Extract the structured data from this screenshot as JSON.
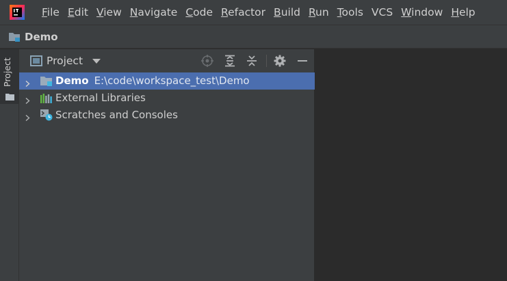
{
  "menubar": {
    "items": [
      {
        "mnemonic": "F",
        "rest": "ile"
      },
      {
        "mnemonic": "E",
        "rest": "dit"
      },
      {
        "mnemonic": "V",
        "rest": "iew"
      },
      {
        "mnemonic": "N",
        "rest": "avigate"
      },
      {
        "mnemonic": "C",
        "rest": "ode"
      },
      {
        "mnemonic": "R",
        "rest": "efactor"
      },
      {
        "mnemonic": "B",
        "rest": "uild"
      },
      {
        "mnemonic": "R",
        "rest": "un"
      },
      {
        "mnemonic": "T",
        "rest": "ools"
      },
      {
        "mnemonic": "VCS",
        "rest": ""
      },
      {
        "mnemonic": "W",
        "rest": "indow"
      },
      {
        "mnemonic": "H",
        "rest": "elp"
      }
    ]
  },
  "navbar": {
    "project": "Demo"
  },
  "toolstrip": {
    "project_tab": "Project"
  },
  "panel": {
    "title": "Project",
    "tree": [
      {
        "name": "Demo",
        "path": "E:\\code\\workspace_test\\Demo",
        "selected": true
      },
      {
        "name": "External Libraries"
      },
      {
        "name": "Scratches and Consoles"
      }
    ]
  },
  "colors": {
    "menubar_bg": "#3c3f41",
    "editor_bg": "#2b2b2b",
    "selection": "#4b6eaf"
  },
  "icons": [
    "intellij-logo-icon",
    "folder-icon",
    "target-icon",
    "expand-all-icon",
    "collapse-all-icon",
    "gear-icon",
    "minimize-icon",
    "chevron-right-icon",
    "library-icon",
    "scratch-icon"
  ]
}
